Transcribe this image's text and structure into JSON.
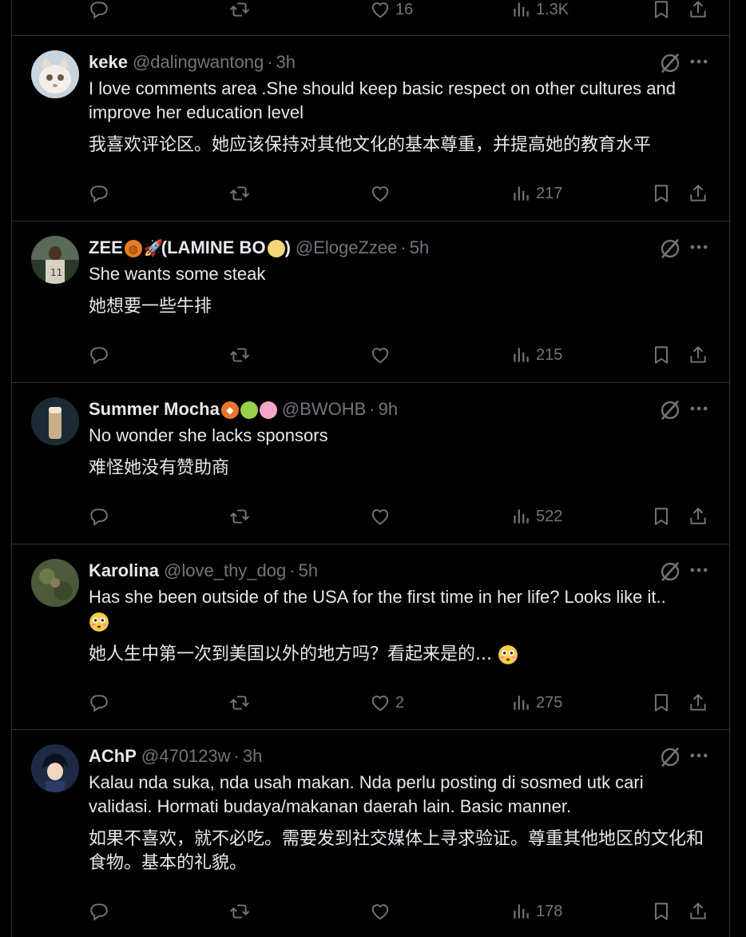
{
  "top_actions": {
    "likes": "16",
    "views": "1.3K"
  },
  "posts": [
    {
      "name": "keke",
      "handle": "@dalingwantong",
      "time": "3h",
      "text": "I love comments area .She should keep basic respect on other cultures and improve her education level",
      "translation": "我喜欢评论区。她应该保持对其他文化的基本尊重，并提高她的教育水平",
      "likes": "",
      "views": "217"
    },
    {
      "name": "ZEE",
      "name_suffix": "(LAMINE BO",
      "name_close": ")",
      "handle": "@ElogeZzee",
      "time": "5h",
      "text": "She wants some steak",
      "translation": "她想要一些牛排",
      "likes": "",
      "views": "215"
    },
    {
      "name": "Summer Mocha",
      "handle": "@BWOHB",
      "time": "9h",
      "text": "No wonder she lacks sponsors",
      "translation": "难怪她没有赞助商",
      "likes": "",
      "views": "522"
    },
    {
      "name": "Karolina",
      "handle": "@love_thy_dog",
      "time": "5h",
      "text": "Has she been outside of the USA for the first time in her life? Looks like it..",
      "translation": "她人生中第一次到美国以外的地方吗？看起来是的...",
      "likes": "2",
      "views": "275"
    },
    {
      "name": "AChP",
      "handle": "@470123w",
      "time": "3h",
      "text": "Kalau nda suka, nda usah makan. Nda perlu posting di sosmed utk cari validasi. Hormati budaya/makanan daerah lain. Basic manner.",
      "translation": "如果不喜欢，就不必吃。需要发到社交媒体上寻求验证。尊重其他地区的文化和食物。基本的礼貌。",
      "likes": "",
      "views": "178"
    }
  ],
  "icons": {
    "reply": "reply-icon",
    "retweet": "retweet-icon",
    "like": "heart-icon",
    "views": "views-icon",
    "bookmark": "bookmark-icon",
    "share": "share-icon",
    "grok": "grok-icon",
    "more": "more-icon"
  },
  "colors": {
    "background": "#000000",
    "text": "#e7e9ea",
    "muted": "#71767b",
    "border": "#2f3336"
  }
}
